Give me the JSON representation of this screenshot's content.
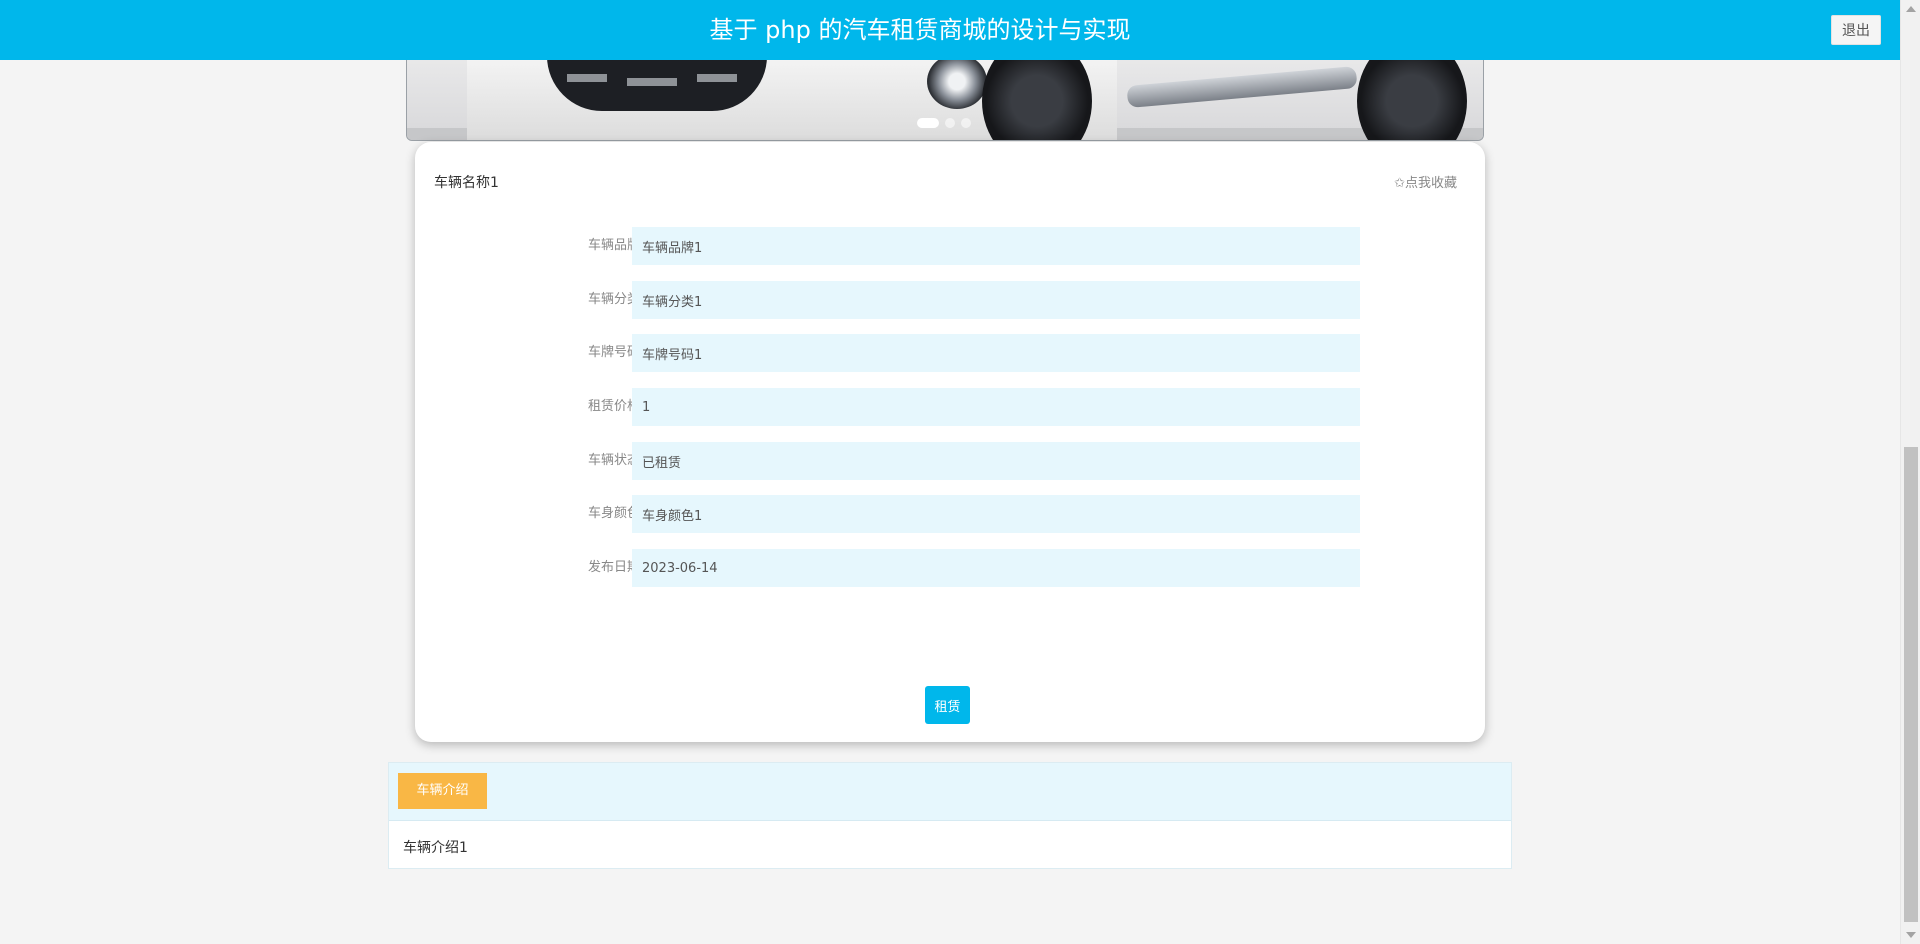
{
  "header": {
    "title": "基于 php 的汽车租赁商城的设计与实现",
    "logout_label": "退出"
  },
  "carousel": {
    "slide_count": 3,
    "active_index": 0
  },
  "detail": {
    "name": "车辆名称1",
    "favorite_label": "✩点我收藏",
    "fields": [
      {
        "label": "车辆品牌",
        "value": "车辆品牌1"
      },
      {
        "label": "车辆分类",
        "value": "车辆分类1"
      },
      {
        "label": "车牌号码",
        "value": "车牌号码1"
      },
      {
        "label": "租赁价格",
        "value": "1"
      },
      {
        "label": "车辆状态",
        "value": "已租赁"
      },
      {
        "label": "车身颜色",
        "value": "车身颜色1"
      },
      {
        "label": "发布日期",
        "value": "2023-06-14"
      }
    ],
    "rent_label": "租赁"
  },
  "intro": {
    "tab_label": "车辆介绍",
    "content": "车辆介绍1"
  },
  "colors": {
    "primary": "#00b7eb",
    "accent": "#f9b745",
    "field_bg": "#e6f7fd"
  },
  "icons": {
    "favorite": "star-outline-icon"
  }
}
